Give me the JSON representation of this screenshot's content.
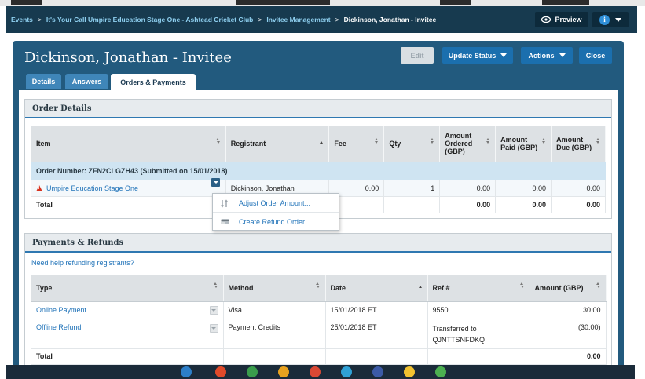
{
  "breadcrumb": {
    "items": [
      "Events",
      "It's Your Call Umpire Education Stage One - Ashtead Cricket Club",
      "Invitee Management"
    ],
    "current": "Dickinson, Jonathan - Invitee",
    "separator": ">"
  },
  "top_actions": {
    "preview_label": "Preview",
    "info_label": "i"
  },
  "modal": {
    "title": "Dickinson, Jonathan - Invitee",
    "buttons": {
      "edit": "Edit",
      "update_status": "Update Status",
      "actions": "Actions",
      "close": "Close"
    },
    "tabs": [
      "Details",
      "Answers",
      "Orders & Payments"
    ],
    "active_tab": "Orders & Payments"
  },
  "order_details": {
    "heading": "Order Details",
    "columns": [
      "Item",
      "Registrant",
      "Fee",
      "Qty",
      "Amount Ordered (GBP)",
      "Amount Paid (GBP)",
      "Amount Due (GBP)"
    ],
    "order_group": "Order Number: ZFN2CLGZH43 (Submitted on 15/01/2018)",
    "rows": [
      {
        "item": "Umpire Education Stage One",
        "registrant": "Dickinson, Jonathan",
        "fee": "0.00",
        "qty": "1",
        "ordered": "0.00",
        "paid": "0.00",
        "due": "0.00"
      }
    ],
    "total": {
      "label": "Total",
      "ordered": "0.00",
      "paid": "0.00",
      "due": "0.00"
    }
  },
  "row_menu": {
    "items": [
      "Adjust Order Amount...",
      "Create Refund Order..."
    ]
  },
  "payments": {
    "heading": "Payments & Refunds",
    "help_link": "Need help refunding registrants?",
    "columns": [
      "Type",
      "Method",
      "Date",
      "Ref #",
      "Amount (GBP)"
    ],
    "rows": [
      {
        "type": "Online Payment",
        "method": "Visa",
        "date": "15/01/2018 ET",
        "ref": "9550",
        "amount": "30.00"
      },
      {
        "type": "Offline Refund",
        "method": "Payment Credits",
        "date": "25/01/2018 ET",
        "ref": "Transferred to QJNTTSNFDKQ",
        "amount": "(30.00)"
      }
    ],
    "total": {
      "label": "Total",
      "amount": "0.00"
    }
  },
  "colors": {
    "breadcrumb_bg": "#173a4f",
    "modal_bg": "#225a7e",
    "primary_button": "#1b6fae",
    "link": "#1f72b8",
    "warning": "#d8331f"
  }
}
